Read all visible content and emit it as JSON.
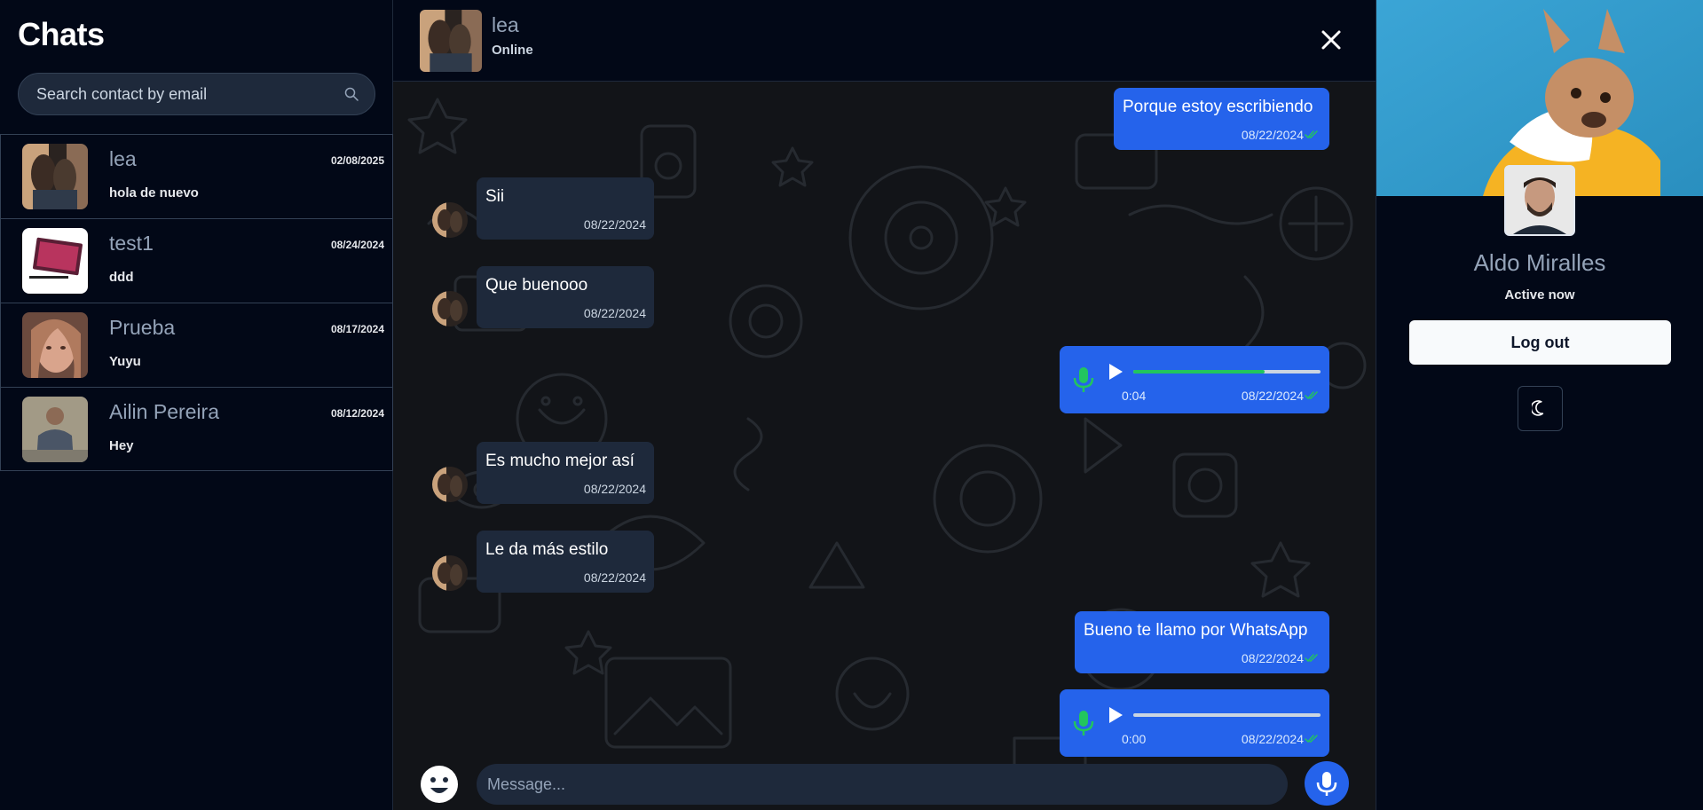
{
  "sidebar": {
    "title": "Chats",
    "search": {
      "placeholder": "Search contact by email",
      "icon": "search-icon"
    },
    "chats": [
      {
        "name": "lea",
        "date": "02/08/2025",
        "preview": "hola de nuevo"
      },
      {
        "name": "test1",
        "date": "08/24/2024",
        "preview": "ddd"
      },
      {
        "name": "Prueba",
        "date": "08/17/2024",
        "preview": "Yuyu"
      },
      {
        "name": "Ailin Pereira",
        "date": "08/12/2024",
        "preview": "Hey"
      }
    ]
  },
  "conversation": {
    "contact": {
      "name": "lea",
      "status": "Online"
    },
    "messages": [
      {
        "direction": "out",
        "type": "text",
        "text": "Porque estoy escribiendo",
        "time": "08/22/2024"
      },
      {
        "direction": "in",
        "type": "text",
        "text": "Sii",
        "time": "08/22/2024"
      },
      {
        "direction": "in",
        "type": "text",
        "text": "Que buenooo",
        "time": "08/22/2024"
      },
      {
        "direction": "out",
        "type": "audio",
        "duration": "0:04",
        "progress": 0.7,
        "time": "08/22/2024"
      },
      {
        "direction": "in",
        "type": "text",
        "text": "Es mucho mejor así",
        "time": "08/22/2024"
      },
      {
        "direction": "in",
        "type": "text",
        "text": "Le da más estilo",
        "time": "08/22/2024"
      },
      {
        "direction": "out",
        "type": "text",
        "text": "Bueno te llamo por WhatsApp",
        "time": "08/22/2024"
      },
      {
        "direction": "out",
        "type": "audio",
        "duration": "0:00",
        "progress": 0,
        "time": "08/22/2024"
      }
    ],
    "composer": {
      "placeholder": "Message..."
    }
  },
  "profile": {
    "name": "Aldo Miralles",
    "status": "Active now",
    "logout_label": "Log out",
    "theme_icon": "moon-icon"
  },
  "colors": {
    "background": "#020817",
    "accent": "#2563eb",
    "incoming_bubble": "#1e293b",
    "audio_progress": "#22c55e",
    "read_ticks": "#22c55e"
  }
}
